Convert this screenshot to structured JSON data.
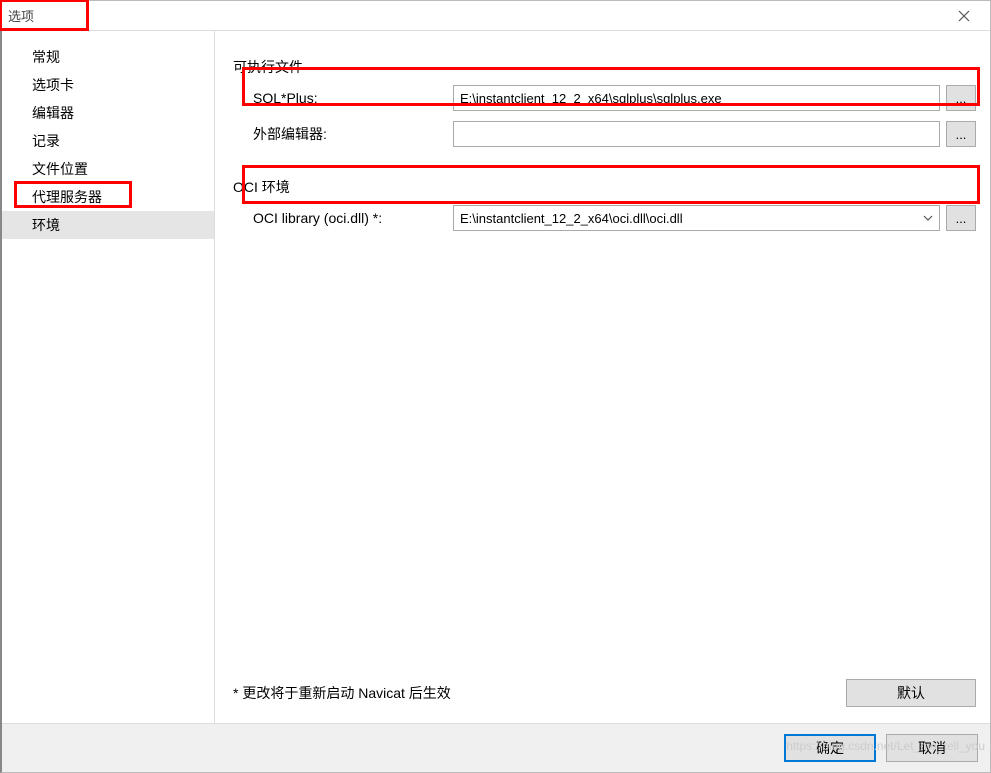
{
  "window": {
    "title": "选项"
  },
  "sidebar": {
    "items": [
      {
        "label": "常规"
      },
      {
        "label": "选项卡"
      },
      {
        "label": "编辑器"
      },
      {
        "label": "记录"
      },
      {
        "label": "文件位置"
      },
      {
        "label": "代理服务器"
      },
      {
        "label": "环境"
      }
    ],
    "selected_index": 6
  },
  "content": {
    "section1_title": "可执行文件",
    "sqlplus_label": "SQL*Plus:",
    "sqlplus_value": "E:\\instantclient_12_2_x64\\sqlplus\\sqlplus.exe",
    "external_editor_label": "外部编辑器:",
    "external_editor_value": "",
    "section2_title": "OCI 环境",
    "oci_label": "OCI library (oci.dll) *:",
    "oci_value": "E:\\instantclient_12_2_x64\\oci.dll\\oci.dll",
    "browse_label": "...",
    "restart_note": "* 更改将于重新启动 Navicat 后生效",
    "default_button": "默认"
  },
  "footer": {
    "ok": "确定",
    "cancel": "取消"
  },
  "watermark": "https://blog.csdn.net/Let_me_tell_you"
}
